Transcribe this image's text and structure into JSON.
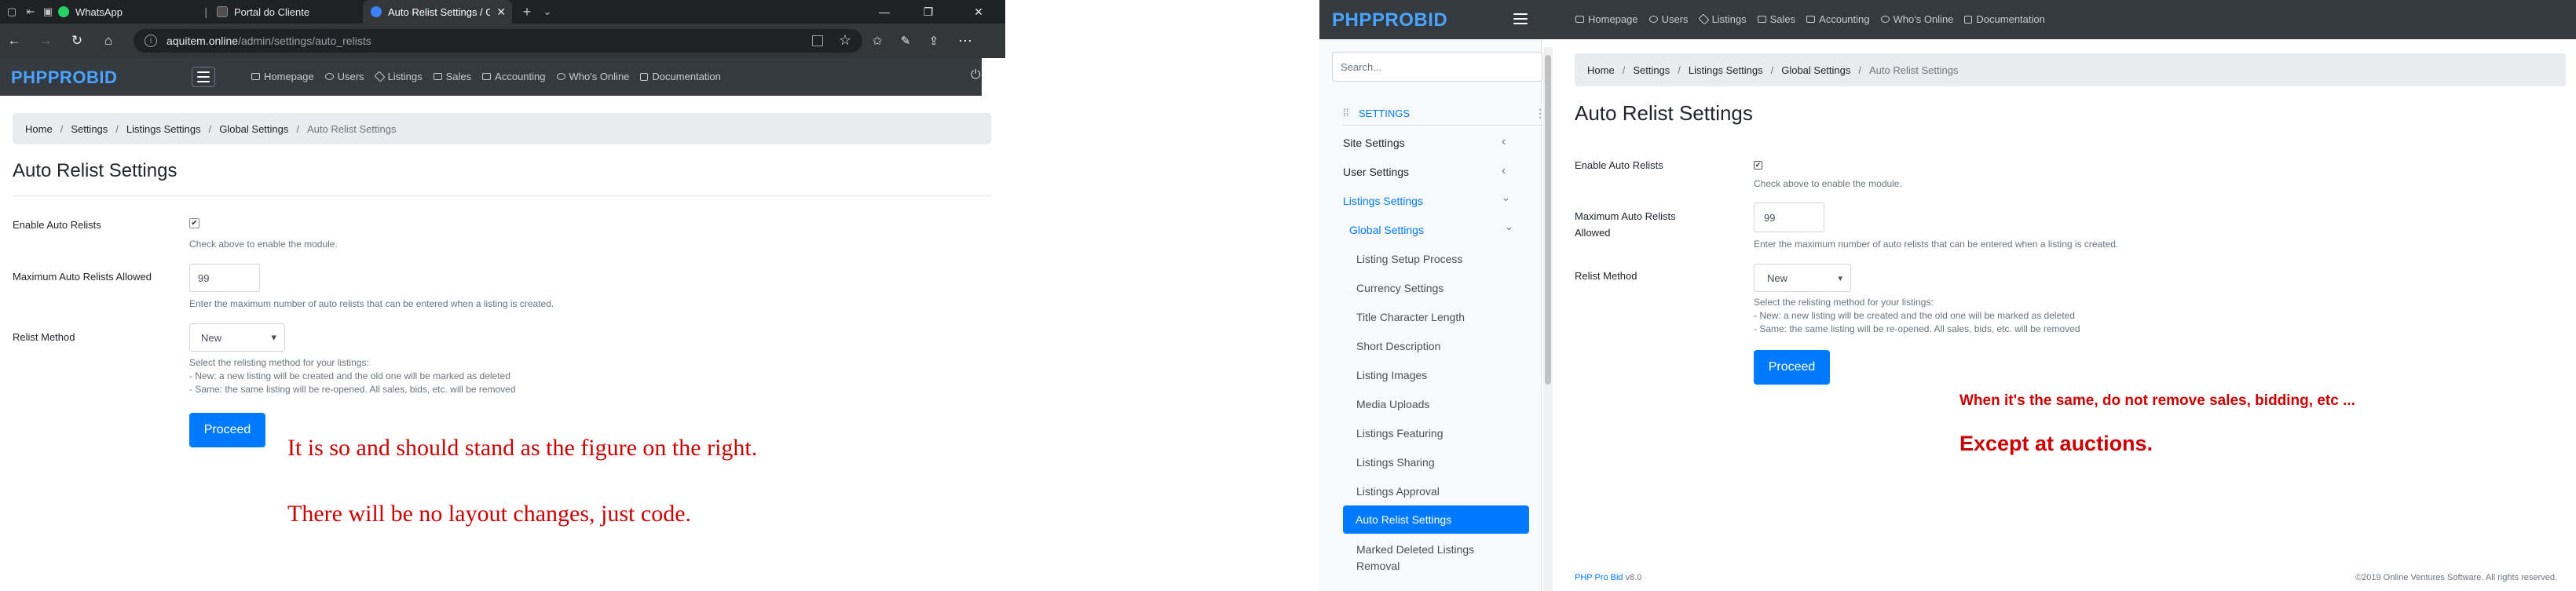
{
  "browser": {
    "tabs": [
      {
        "label": "WhatsApp",
        "active": false
      },
      {
        "label": "Portal do Cliente",
        "active": false
      },
      {
        "label": "Auto Relist Settings / Gl",
        "active": true
      }
    ],
    "new_tab": "+",
    "tab_menu": "⌄",
    "window_controls": {
      "minimize": "—",
      "restore": "❐",
      "close": "✕"
    },
    "nav": {
      "back": "←",
      "forward": "→",
      "reload": "↻",
      "home": "⌂"
    },
    "url_domain": "aquitem.online",
    "url_path": "/admin/settings/auto_relists",
    "star": "☆",
    "more": "⋯"
  },
  "app": {
    "logo_php": "PHP",
    "logo_pr": "PR",
    "logo_o": "O",
    "logo_bid": "BID",
    "topnav": [
      {
        "label": "Homepage",
        "icon": "monitor-icon"
      },
      {
        "label": "Users",
        "icon": "users-icon"
      },
      {
        "label": "Listings",
        "icon": "layers-icon"
      },
      {
        "label": "Sales",
        "icon": "briefcase-icon"
      },
      {
        "label": "Accounting",
        "icon": "calculator-icon"
      },
      {
        "label": "Who's Online",
        "icon": "online-icon"
      },
      {
        "label": "Documentation",
        "icon": "book-icon"
      }
    ],
    "power": "⏻",
    "breadcrumb": {
      "items": [
        "Home",
        "Settings",
        "Listings Settings",
        "Global Settings"
      ],
      "current": "Auto Relist Settings",
      "sep": "/"
    },
    "page_title": "Auto Relist Settings",
    "form": {
      "enable_label": "Enable Auto Relists",
      "enable_checked": true,
      "enable_check_glyph": "✔",
      "enable_help": "Check above to enable the module.",
      "max_label": "Maximum Auto Relists Allowed",
      "max_value": "99",
      "max_help": "Enter the maximum number of auto relists that can be entered when a listing is created.",
      "method_label": "Relist Method",
      "method_value": "New",
      "method_caret": "▾",
      "method_help_1": "Select the relisting method for your listings:",
      "method_help_2": "- New: a new listing will be created and the old one will be marked as deleted",
      "method_help_3": "- Same: the same listing will be re-opened. All sales, bids, etc. will be removed",
      "proceed": "Proceed"
    },
    "sidebar": {
      "search_placeholder": "Search...",
      "settings_head": "SETTINGS",
      "drag_glyph": "⁞⁞",
      "kebab_glyph": "⋮",
      "chev_left": "‹",
      "chev_down": "⌄",
      "items": [
        "Site Settings",
        "User Settings",
        "Listings Settings",
        "Global Settings",
        "Listing Setup Process",
        "Currency Settings",
        "Title Character Length",
        "Short Description",
        "Listing Images",
        "Media Uploads",
        "Listings Featuring",
        "Listings Sharing",
        "Listings Approval",
        "Auto Relist Settings",
        "Marked Deleted Listings",
        "Removal"
      ]
    },
    "footer_left_link": "PHP Pro Bid",
    "footer_left_version": " v8.0",
    "footer_right": "©2019 Online Ventures Software. All rights reserved."
  },
  "annotations": {
    "left_1": "It is so and should stand as the figure on the right.",
    "left_2": "There will be no layout changes, just code.",
    "right_1": "When it's the same, do not remove sales, bidding, etc ...",
    "right_2": "Except at auctions."
  },
  "colors": {
    "accent": "#007bff",
    "annotation": "#cc0000",
    "header": "#343a40",
    "logo": "#4aa3ff"
  }
}
